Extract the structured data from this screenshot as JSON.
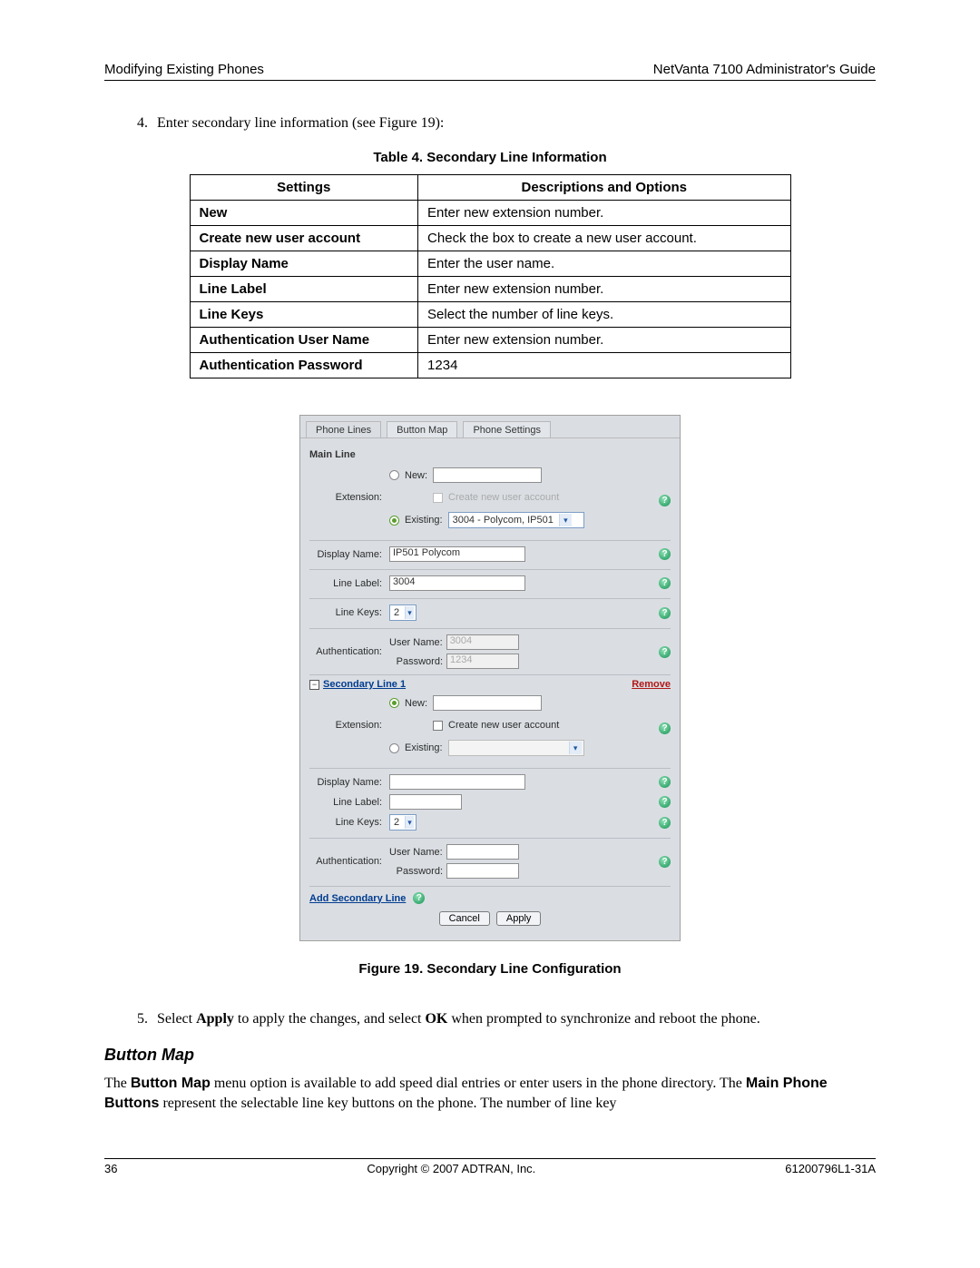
{
  "header": {
    "left": "Modifying Existing Phones",
    "right": "NetVanta 7100 Administrator's Guide"
  },
  "step4": {
    "num": "4.",
    "text": "Enter secondary line information (see Figure 19):"
  },
  "table4": {
    "caption": "Table 4.  Secondary Line Information",
    "head": [
      "Settings",
      "Descriptions and Options"
    ],
    "rows": [
      [
        "New",
        "Enter new extension number."
      ],
      [
        "Create new user account",
        "Check the box to create a new user account."
      ],
      [
        "Display Name",
        "Enter the user name."
      ],
      [
        "Line Label",
        "Enter new extension number."
      ],
      [
        "Line Keys",
        "Select the number of line keys."
      ],
      [
        "Authentication User Name",
        "Enter new extension number."
      ],
      [
        "Authentication Password",
        "1234"
      ]
    ]
  },
  "panel": {
    "tabs": [
      "Phone Lines",
      "Button Map",
      "Phone Settings"
    ],
    "main": {
      "title": "Main Line",
      "extension_label": "Extension:",
      "new_label": "New:",
      "existing_label": "Existing:",
      "create_user_label": "Create new user account",
      "existing_selected": "3004 - Polycom, IP501",
      "display_name_label": "Display Name:",
      "display_name_value": "IP501 Polycom",
      "line_label_label": "Line Label:",
      "line_label_value": "3004",
      "line_keys_label": "Line Keys:",
      "line_keys_value": "2",
      "auth_label": "Authentication:",
      "auth_user_label": "User Name:",
      "auth_user_value": "3004",
      "auth_pass_label": "Password:",
      "auth_pass_value": "1234"
    },
    "secondary": {
      "title": "Secondary Line 1",
      "remove_label": "Remove",
      "extension_label": "Extension:",
      "new_label": "New:",
      "existing_label": "Existing:",
      "create_user_label": "Create new user account",
      "display_name_label": "Display Name:",
      "line_label_label": "Line Label:",
      "line_keys_label": "Line Keys:",
      "line_keys_value": "2",
      "auth_label": "Authentication:",
      "auth_user_label": "User Name:",
      "auth_pass_label": "Password:"
    },
    "add_link": "Add Secondary Line",
    "buttons": {
      "cancel": "Cancel",
      "apply": "Apply"
    }
  },
  "figure19": "Figure 19.  Secondary Line Configuration",
  "step5": {
    "num": "5.",
    "pre": "Select ",
    "b1": "Apply",
    "mid1": " to apply the changes, and select ",
    "b2": "OK",
    "post": " when prompted to synchronize and reboot the phone."
  },
  "button_map": {
    "heading": "Button Map",
    "s1a": "The ",
    "s1b": "Button Map",
    "s1c": " menu option is available to add speed dial entries or enter users in the phone directory. The ",
    "s1d": "Main Phone Buttons",
    "s1e": " represent the selectable line key buttons on the phone. The number of line key"
  },
  "footer": {
    "left": "36",
    "center": "Copyright © 2007 ADTRAN, Inc.",
    "right": "61200796L1-31A"
  }
}
